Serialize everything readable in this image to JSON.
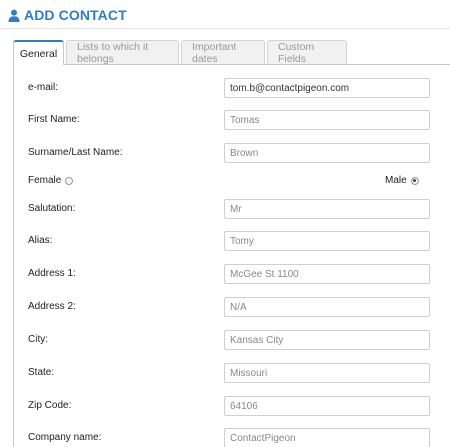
{
  "header": {
    "title": "ADD CONTACT",
    "icon": "user-icon",
    "accent": "#2d7fbf"
  },
  "tabs": [
    {
      "label": "General",
      "active": true
    },
    {
      "label": "Lists to which it belongs",
      "active": false
    },
    {
      "label": "Important dates",
      "active": false
    },
    {
      "label": "Custom Fields",
      "active": false
    }
  ],
  "form": {
    "email": {
      "label": "e-mail:",
      "value": "tom.b@contactpigeon.com"
    },
    "first_name": {
      "label": "First Name:",
      "value": "Tomas"
    },
    "surname": {
      "label": "Surname/Last Name:",
      "value": "Brown"
    },
    "gender": {
      "female_label": "Female",
      "male_label": "Male",
      "selected": "Male"
    },
    "salutation": {
      "label": "Salutation:",
      "value": "Mr"
    },
    "alias": {
      "label": "Alias:",
      "value": "Tomy"
    },
    "address1": {
      "label": "Address 1:",
      "value": "McGee St 1100"
    },
    "address2": {
      "label": "Address 2:",
      "value": "N/A"
    },
    "city": {
      "label": "City:",
      "value": "Kansas City"
    },
    "state": {
      "label": "State:",
      "value": "Missouri"
    },
    "zip": {
      "label": "Zip Code:",
      "value": "64106"
    },
    "company": {
      "label": "Company name:",
      "value": "ContactPigeon"
    }
  }
}
